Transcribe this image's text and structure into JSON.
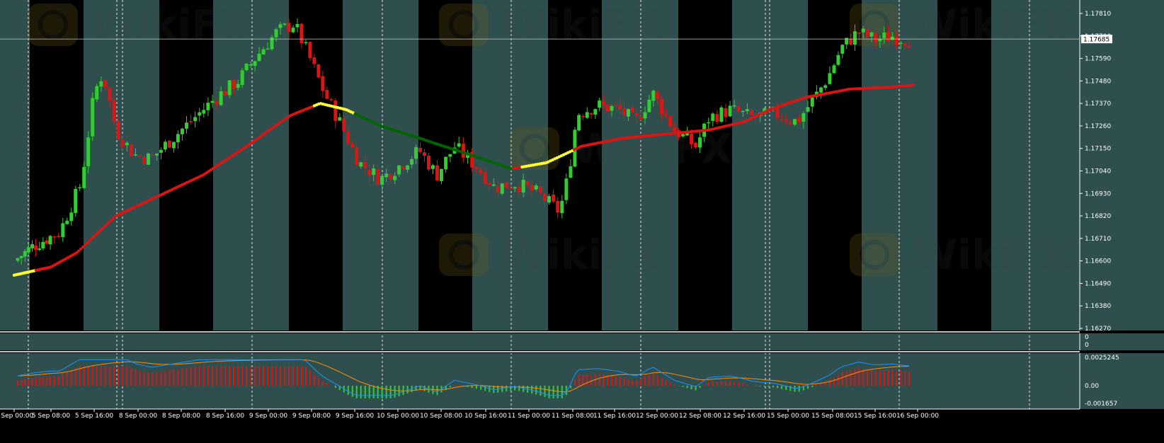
{
  "colors": {
    "background": "#2f4f4f",
    "session_band": "#000000",
    "bull_candle": "#32cd32",
    "bear_candle": "#dc1414",
    "ma_rising": "#dc1414",
    "ma_turning": "#ffff33",
    "ma_falling": "#006400",
    "macd_hist_pos": "#dc1414",
    "macd_hist_neg": "#32cd32",
    "macd_main": "#1e90ff",
    "macd_signal": "#ff8c00",
    "grid_separator": "#ffffff"
  },
  "icons": {
    "watermark": "wikifx-logo"
  },
  "watermark_text": "WikiFX",
  "price_axis": {
    "current_price": "1.17685",
    "current_price_value": 1.17685,
    "ticks": [
      "1.17810",
      "1.17700",
      "1.17590",
      "1.17480",
      "1.17370",
      "1.17260",
      "1.17150",
      "1.17040",
      "1.16930",
      "1.16820",
      "1.16710",
      "1.16600",
      "1.16490",
      "1.16380",
      "1.16270"
    ],
    "range": [
      1.1627,
      1.1781
    ]
  },
  "middle_panel": {
    "labels": [
      "0",
      "0"
    ]
  },
  "macd_panel": {
    "ticks": [
      "0.0025245",
      "0.00",
      "-0.001657"
    ],
    "range": [
      -0.001657,
      0.0025245
    ]
  },
  "time_axis": {
    "labels": [
      "5 Sep 00:00",
      "5 Sep 08:00",
      "5 Sep 16:00",
      "8 Sep 00:00",
      "8 Sep 08:00",
      "8 Sep 16:00",
      "9 Sep 00:00",
      "9 Sep 08:00",
      "9 Sep 16:00",
      "10 Sep 00:00",
      "10 Sep 08:00",
      "10 Sep 16:00",
      "11 Sep 00:00",
      "11 Sep 08:00",
      "11 Sep 16:00",
      "12 Sep 00:00",
      "12 Sep 08:00",
      "12 Sep 16:00",
      "15 Sep 00:00",
      "15 Sep 08:00",
      "15 Sep 16:00",
      "16 Sep 00:00"
    ]
  },
  "chart_data": {
    "type": "candlestick",
    "symbol_scale": "price",
    "ylim": [
      1.1627,
      1.1781
    ],
    "x": [
      "5 Sep 00:00",
      "5 Sep 08:00",
      "5 Sep 16:00",
      "8 Sep 00:00",
      "8 Sep 08:00",
      "8 Sep 16:00",
      "9 Sep 00:00",
      "9 Sep 08:00",
      "9 Sep 16:00",
      "10 Sep 00:00",
      "10 Sep 08:00",
      "10 Sep 16:00",
      "11 Sep 00:00",
      "11 Sep 08:00",
      "11 Sep 16:00",
      "12 Sep 00:00",
      "12 Sep 08:00",
      "12 Sep 16:00",
      "15 Sep 00:00",
      "15 Sep 08:00",
      "15 Sep 16:00",
      "16 Sep 00:00"
    ],
    "close_path": [
      [
        0,
        1.166
      ],
      [
        0.5,
        1.1667
      ],
      [
        1.2,
        1.1674
      ],
      [
        1.7,
        1.1698
      ],
      [
        2.0,
        1.1742
      ],
      [
        2.2,
        1.1752
      ],
      [
        2.5,
        1.1724
      ],
      [
        2.9,
        1.1712
      ],
      [
        3.3,
        1.171
      ],
      [
        3.7,
        1.1718
      ],
      [
        4.2,
        1.1728
      ],
      [
        4.8,
        1.174
      ],
      [
        5.3,
        1.1748
      ],
      [
        5.8,
        1.1762
      ],
      [
        6.2,
        1.1772
      ],
      [
        6.6,
        1.1776
      ],
      [
        6.9,
        1.1762
      ],
      [
        7.3,
        1.1742
      ],
      [
        7.7,
        1.1726
      ],
      [
        8.1,
        1.1708
      ],
      [
        8.6,
        1.17
      ],
      [
        9.0,
        1.1706
      ],
      [
        9.5,
        1.1714
      ],
      [
        9.9,
        1.1702
      ],
      [
        10.3,
        1.1716
      ],
      [
        10.8,
        1.1706
      ],
      [
        11.2,
        1.1696
      ],
      [
        11.7,
        1.1698
      ],
      [
        12.2,
        1.1693
      ],
      [
        12.7,
        1.1684
      ],
      [
        12.9,
        1.1702
      ],
      [
        13.1,
        1.1732
      ],
      [
        13.6,
        1.1736
      ],
      [
        14.1,
        1.1734
      ],
      [
        14.5,
        1.1728
      ],
      [
        14.9,
        1.1742
      ],
      [
        15.4,
        1.1724
      ],
      [
        15.9,
        1.1716
      ],
      [
        16.2,
        1.173
      ],
      [
        16.7,
        1.1734
      ],
      [
        17.2,
        1.173
      ],
      [
        17.7,
        1.1732
      ],
      [
        18.2,
        1.1728
      ],
      [
        18.6,
        1.174
      ],
      [
        18.9,
        1.175
      ],
      [
        19.2,
        1.1764
      ],
      [
        19.6,
        1.1772
      ],
      [
        20.0,
        1.1768
      ],
      [
        20.4,
        1.177
      ],
      [
        20.8,
        1.1768
      ]
    ],
    "ma_path": [
      [
        0,
        1.1653
      ],
      [
        1.0,
        1.1657
      ],
      [
        1.6,
        1.1664
      ],
      [
        2.5,
        1.1682
      ],
      [
        3.5,
        1.1692
      ],
      [
        4.5,
        1.1702
      ],
      [
        5.5,
        1.1716
      ],
      [
        6.5,
        1.1731
      ],
      [
        7.2,
        1.1737
      ],
      [
        7.8,
        1.1734
      ],
      [
        8.6,
        1.1726
      ],
      [
        9.5,
        1.172
      ],
      [
        10.5,
        1.1713
      ],
      [
        11.6,
        1.1705
      ],
      [
        12.4,
        1.1708
      ],
      [
        13.2,
        1.1716
      ],
      [
        14.2,
        1.172
      ],
      [
        15.2,
        1.1722
      ],
      [
        16.2,
        1.1724
      ],
      [
        17.0,
        1.1728
      ],
      [
        17.6,
        1.1734
      ],
      [
        18.4,
        1.174
      ],
      [
        19.4,
        1.1744
      ],
      [
        20.4,
        1.1745
      ],
      [
        20.9,
        1.1746
      ]
    ],
    "series": [
      {
        "name": "",
        "kind": "macd_histogram"
      },
      {
        "name": "",
        "kind": "macd_main"
      },
      {
        "name": "",
        "kind": "macd_signal"
      }
    ]
  }
}
